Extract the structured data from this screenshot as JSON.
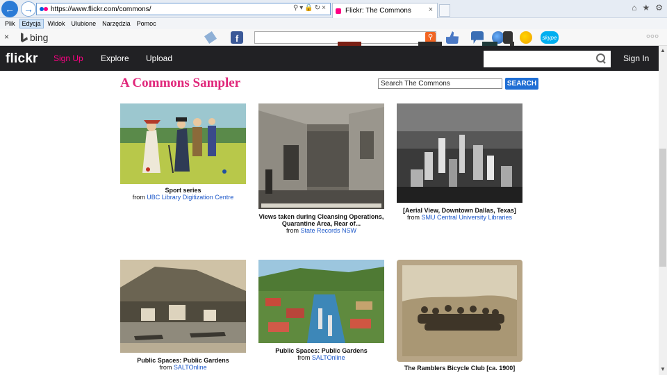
{
  "browser": {
    "address_url": "https://www.flickr.com/commons/",
    "tab_title": "Flickr: The Commons",
    "menu": [
      "Plik",
      "Edycja",
      "Widok",
      "Ulubione",
      "Narzędzia",
      "Pomoc"
    ],
    "active_menu": "Edycja",
    "toolbar_brand": "bing"
  },
  "flickr_nav": {
    "logo": "flickr",
    "signup": "Sign Up",
    "explore": "Explore",
    "upload": "Upload",
    "signin": "Sign In"
  },
  "page": {
    "title": "A Commons Sampler",
    "search_value": "Search The Commons",
    "search_button": "SEARCH"
  },
  "items": [
    {
      "title": "Sport series",
      "from": "from",
      "source": "UBC Library Digitization Centre"
    },
    {
      "title": "Views taken during Cleansing Operations, Quarantine Area, Rear of...",
      "from": "from",
      "source": "State Records NSW"
    },
    {
      "title": "[Aerial View, Downtown Dallas, Texas]",
      "from": "from",
      "source": "SMU Central University Libraries"
    },
    {
      "title": "Public Spaces: Public Gardens",
      "from": "from",
      "source": "SALTOnline"
    },
    {
      "title": "Public Spaces: Public Gardens",
      "from": "from",
      "source": "SALTOnline"
    },
    {
      "title": "The Ramblers Bicycle Club [ca. 1900]",
      "from": "",
      "source": ""
    }
  ],
  "colors": {
    "accent_pink": "#ff0084",
    "title_pink": "#e0267a",
    "link_blue": "#1a56c9",
    "flickr_bar": "#212124",
    "search_button": "#1f6ed4"
  }
}
